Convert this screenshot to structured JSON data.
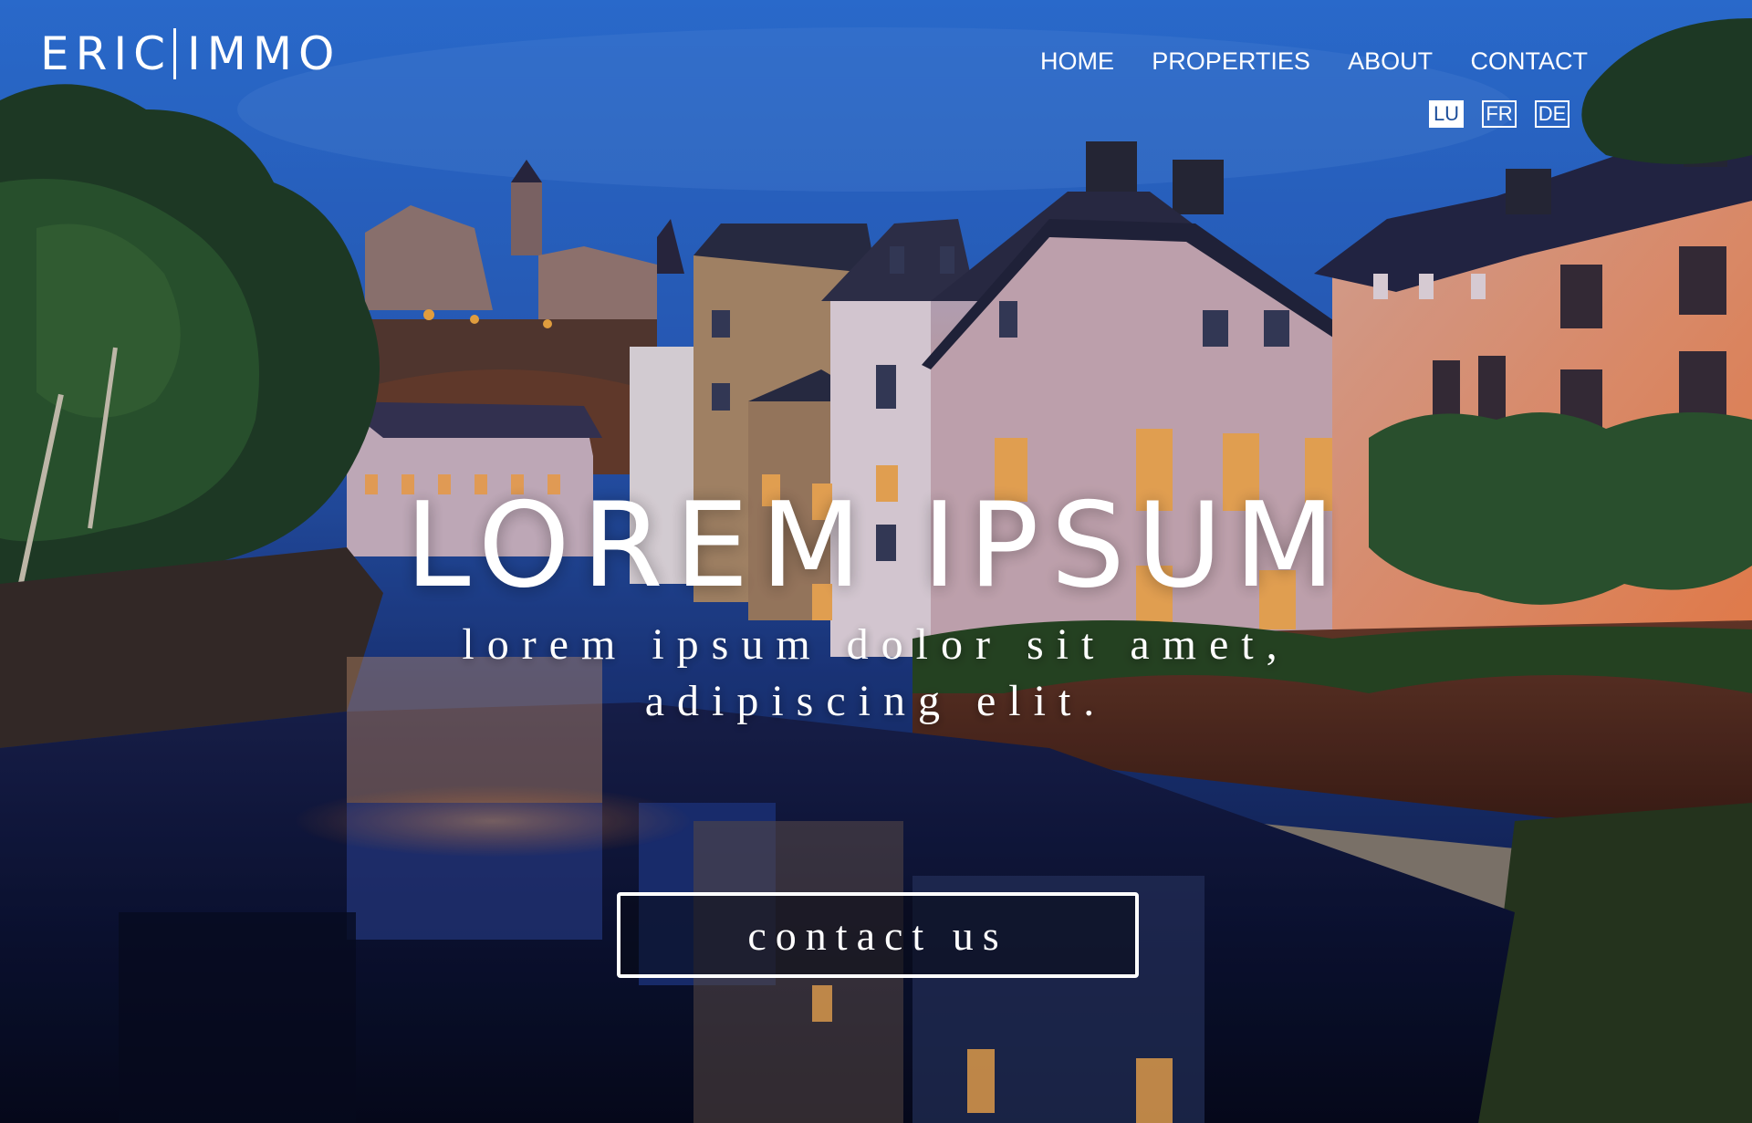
{
  "brand": {
    "name_left": "ERIC",
    "name_right": "IMMO"
  },
  "nav": {
    "home": "HOME",
    "properties": "PROPERTIES",
    "about": "ABOUT",
    "contact": "CONTACT"
  },
  "languages": {
    "lu": "LU",
    "fr": "FR",
    "de": "DE",
    "active": "LU"
  },
  "hero": {
    "title": "LOREM IPSUM",
    "subtitle_line1": "lorem ipsum dolor sit amet,",
    "subtitle_line2": "adipiscing elit.",
    "cta_label": "contact us"
  },
  "colors": {
    "text": "#ffffff",
    "sky": "#2e6fd8",
    "water": "#0e1a4a",
    "lamp_glow": "#ff9a3c"
  }
}
